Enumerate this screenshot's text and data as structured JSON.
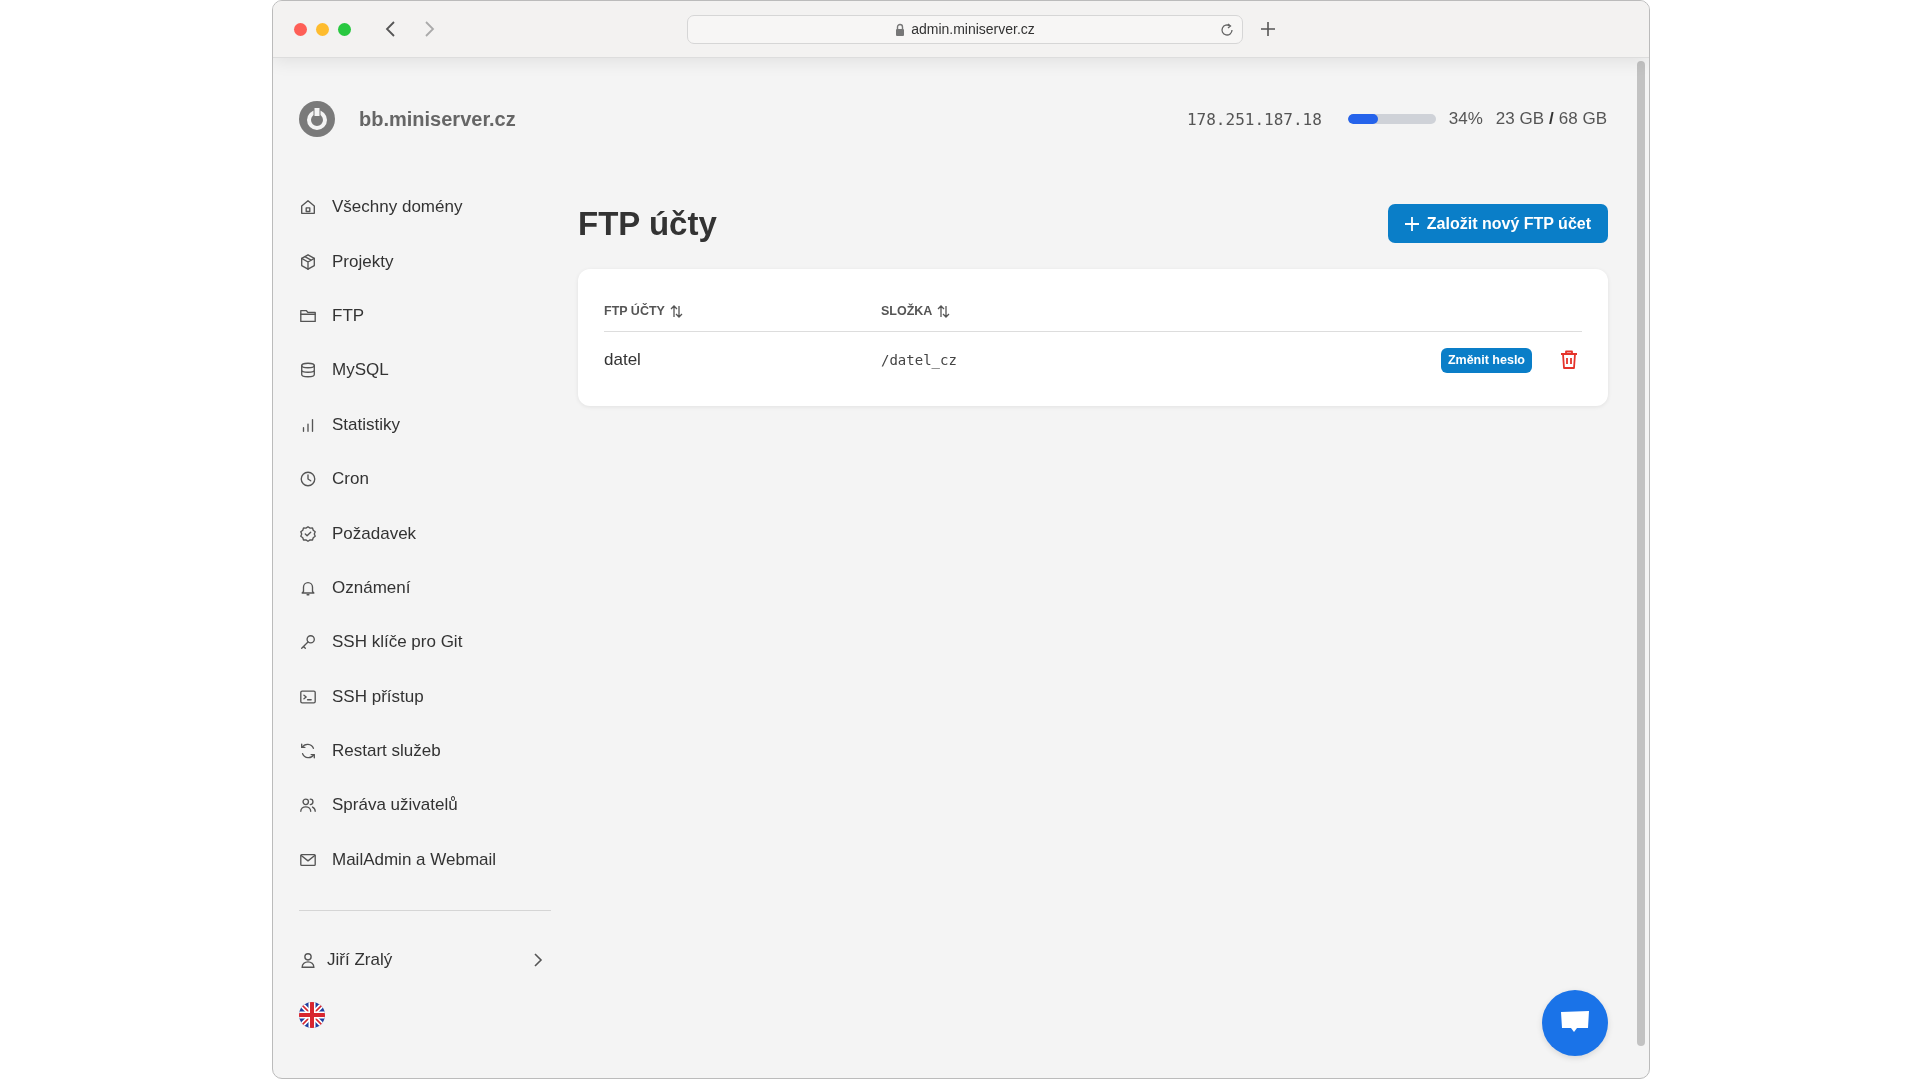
{
  "browser": {
    "url": "admin.miniserver.cz"
  },
  "header": {
    "site": "bb.miniserver.cz",
    "ip": "178.251.187.18",
    "disk": {
      "level": 0.34,
      "percent": "34%",
      "used": "23 GB",
      "separator": "/",
      "total": "68 GB"
    }
  },
  "sidebar": {
    "items": [
      {
        "label": "Všechny domény"
      },
      {
        "label": "Projekty"
      },
      {
        "label": "FTP"
      },
      {
        "label": "MySQL"
      },
      {
        "label": "Statistiky"
      },
      {
        "label": "Cron"
      },
      {
        "label": "Požadavek"
      },
      {
        "label": "Oznámení"
      },
      {
        "label": "SSH klíče pro Git"
      },
      {
        "label": "SSH přístup"
      },
      {
        "label": "Restart služeb"
      },
      {
        "label": "Správa uživatelů"
      },
      {
        "label": "MailAdmin a Webmail"
      }
    ],
    "user": "Jiří Zralý"
  },
  "page": {
    "title": "FTP účty",
    "new_button": "Založit nový FTP účet"
  },
  "table": {
    "columns": [
      "FTP ÚČTY",
      "SLOŽKA"
    ],
    "rows": [
      {
        "account": "datel",
        "folder": "/datel_cz",
        "action": "Změnit heslo"
      }
    ]
  }
}
